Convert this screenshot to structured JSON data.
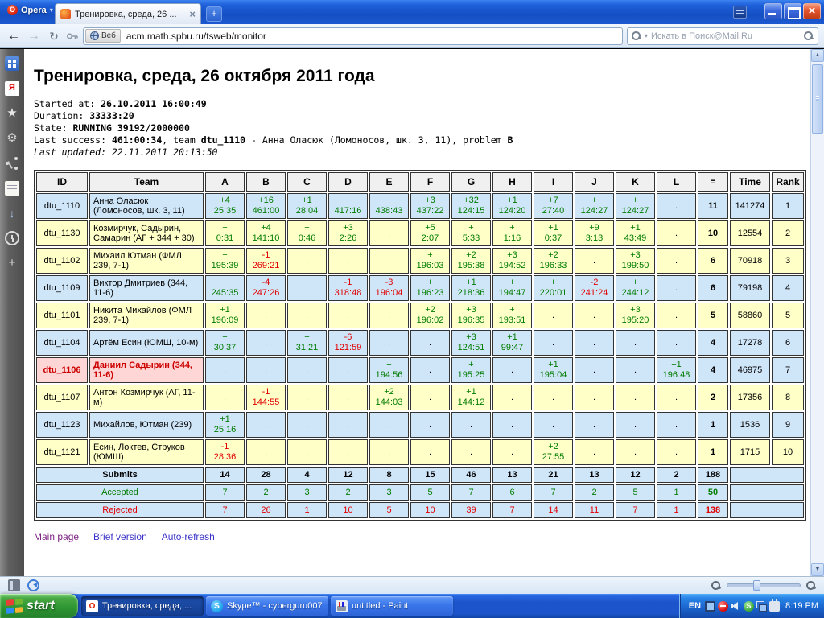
{
  "colors": {
    "accepted": "#007c00",
    "rejected": "#e00000",
    "row_blue": "#cfe5f8",
    "row_yellow": "#ffffc8",
    "header_bg": "#f0f0f0",
    "highlight_bg": "#ffd6d6",
    "highlight_text": "#cc0000"
  },
  "browser": {
    "app_name": "Opera",
    "tab_title": "Тренировка, среда, 26 ...",
    "address_scheme": "Веб",
    "address": "acm.math.spbu.ru/tsweb/monitor",
    "search_placeholder": "Искать в Поиск@Mail.Ru"
  },
  "sidebar": {
    "icons": [
      "speed-dial-icon",
      "yandex-icon",
      "bookmarks-icon",
      "widgets-icon",
      "opera-link-icon",
      "notes-icon",
      "downloads-icon",
      "history-icon",
      "add-panel-icon"
    ],
    "glyphs": {
      "yandex-icon": "Я",
      "bookmarks-icon": "★",
      "widgets-icon": "⚙",
      "downloads-icon": "↓",
      "add-panel-icon": "+"
    }
  },
  "page": {
    "title": "Тренировка, среда, 26 октября 2011 года",
    "info_lines": [
      [
        {
          "t": "Started at: "
        },
        {
          "t": "26.10.2011 16:00:49",
          "b": true
        }
      ],
      [
        {
          "t": "Duration: "
        },
        {
          "t": "33333:20",
          "b": true
        }
      ],
      [
        {
          "t": "State: "
        },
        {
          "t": "RUNNING 39192/2000000",
          "b": true
        }
      ],
      [
        {
          "t": "Last success: "
        },
        {
          "t": "461:00:34",
          "b": true
        },
        {
          "t": ", team "
        },
        {
          "t": "dtu_1110",
          "b": true
        },
        {
          "t": " - Анна Оласюк (Ломоносов, шк. 3, 11)"
        },
        {
          "t": ", problem "
        },
        {
          "t": "B",
          "b": true
        }
      ],
      [
        {
          "t": "Last updated: 22.11.2011 20:13:50",
          "i": true
        }
      ]
    ],
    "footer_links": [
      {
        "label": "Main page",
        "color": "#7b2382"
      },
      {
        "label": "Brief version",
        "color": "#3c34c8"
      },
      {
        "label": "Auto-refresh",
        "color": "#3c34c8"
      }
    ]
  },
  "table": {
    "headers": [
      "ID",
      "Team",
      "A",
      "B",
      "C",
      "D",
      "E",
      "F",
      "G",
      "H",
      "I",
      "J",
      "K",
      "L",
      "=",
      "Time",
      "Rank"
    ],
    "rows": [
      {
        "id": "dtu_1110",
        "team": "Анна Оласюк (Ломоносов, шк. 3, 11)",
        "color": "blue",
        "highlight": false,
        "cells": [
          "+4 25:35",
          "+16 461:00",
          "+1 28:04",
          "+ 417:16",
          "+ 438:43",
          "+3 437:22",
          "+32 124:15",
          "+1 124:20",
          "+7 27:40",
          "+ 124:27",
          "+ 124:27",
          "."
        ],
        "solved": "11",
        "time": "141274",
        "rank": "1"
      },
      {
        "id": "dtu_1130",
        "team": "Козмирчук, Садырин, Самарин (АГ + 344 + 30)",
        "color": "yellow",
        "highlight": false,
        "cells": [
          "+ 0:31",
          "+4 141:10",
          "+ 0:46",
          "+3 2:26",
          ".",
          "+5 2:07",
          "+ 5:33",
          "+ 1:16",
          "+1 0:37",
          "+9 3:13",
          "+1 43:49",
          "."
        ],
        "solved": "10",
        "time": "12554",
        "rank": "2"
      },
      {
        "id": "dtu_1102",
        "team": "Михаил Ютман (ФМЛ 239, 7-1)",
        "color": "yellow",
        "highlight": false,
        "cells": [
          "+ 195:39",
          "-1 269:21",
          ".",
          ".",
          ".",
          "+ 196:03",
          "+2 195:38",
          "+3 194:52",
          "+2 196:33",
          ".",
          "+3 199:50",
          "."
        ],
        "solved": "6",
        "time": "70918",
        "rank": "3"
      },
      {
        "id": "dtu_1109",
        "team": "Виктор Дмитриев (344, 11-6)",
        "color": "blue",
        "highlight": false,
        "cells": [
          "+ 245:35",
          "-4 247:26",
          ".",
          "-1 318:48",
          "-3 196:04",
          "+ 196:23",
          "+1 218:36",
          "+ 194:47",
          "+ 220:01",
          "-2 241:24",
          "+ 244:12",
          "."
        ],
        "solved": "6",
        "time": "79198",
        "rank": "4"
      },
      {
        "id": "dtu_1101",
        "team": "Никита Михайлов (ФМЛ 239, 7-1)",
        "color": "yellow",
        "highlight": false,
        "cells": [
          "+1 196:09",
          ".",
          ".",
          ".",
          ".",
          "+2 196:02",
          "+3 196:35",
          "+ 193:51",
          ".",
          ".",
          "+3 195:20",
          "."
        ],
        "solved": "5",
        "time": "58860",
        "rank": "5"
      },
      {
        "id": "dtu_1104",
        "team": "Артём Есин (ЮМШ, 10-м)",
        "color": "blue",
        "highlight": false,
        "cells": [
          "+ 30:37",
          ".",
          "+ 31:21",
          "-6 121:59",
          ".",
          ".",
          "+3 124:51",
          "+1 99:47",
          ".",
          ".",
          ".",
          "."
        ],
        "solved": "4",
        "time": "17278",
        "rank": "6"
      },
      {
        "id": "dtu_1106",
        "team": "Даниил Садырин (344, 11-6)",
        "color": "blue",
        "highlight": true,
        "cells": [
          ".",
          ".",
          ".",
          ".",
          "+ 194:56",
          ".",
          "+ 195:25",
          ".",
          "+1 195:04",
          ".",
          ".",
          "+1 196:48"
        ],
        "solved": "4",
        "time": "46975",
        "rank": "7"
      },
      {
        "id": "dtu_1107",
        "team": "Антон Козмирчук (АГ, 11-м)",
        "color": "yellow",
        "highlight": false,
        "cells": [
          ".",
          "-1 144:55",
          ".",
          ".",
          "+2 144:03",
          ".",
          "+1 144:12",
          ".",
          ".",
          ".",
          ".",
          "."
        ],
        "solved": "2",
        "time": "17356",
        "rank": "8"
      },
      {
        "id": "dtu_1123",
        "team": "Михайлов, Ютман (239)",
        "color": "blue",
        "highlight": false,
        "cells": [
          "+1 25:16",
          ".",
          ".",
          ".",
          ".",
          ".",
          ".",
          ".",
          ".",
          ".",
          ".",
          "."
        ],
        "solved": "1",
        "time": "1536",
        "rank": "9"
      },
      {
        "id": "dtu_1121",
        "team": "Есин, Локтев, Струков (ЮМШ)",
        "color": "yellow",
        "highlight": false,
        "cells": [
          "-1 28:36",
          ".",
          ".",
          ".",
          ".",
          ".",
          ".",
          ".",
          "+2 27:55",
          ".",
          ".",
          "."
        ],
        "solved": "1",
        "time": "1715",
        "rank": "10"
      }
    ],
    "summary": [
      {
        "label": "Submits",
        "style": "submits",
        "values": [
          "14",
          "28",
          "4",
          "12",
          "8",
          "15",
          "46",
          "13",
          "21",
          "13",
          "12",
          "2"
        ],
        "total": "188"
      },
      {
        "label": "Accepted",
        "style": "accepted",
        "values": [
          "7",
          "2",
          "3",
          "2",
          "3",
          "5",
          "7",
          "6",
          "7",
          "2",
          "5",
          "1"
        ],
        "total": "50"
      },
      {
        "label": "Rejected",
        "style": "rejected",
        "values": [
          "7",
          "26",
          "1",
          "10",
          "5",
          "10",
          "39",
          "7",
          "14",
          "11",
          "7",
          "1"
        ],
        "total": "138"
      }
    ]
  },
  "statusbar": {
    "icons": [
      "panel-toggle-icon",
      "sync-icon"
    ]
  },
  "taskbar": {
    "start_label": "start",
    "buttons": [
      {
        "label": "Тренировка, среда, ...",
        "icon": "opera",
        "active": true
      },
      {
        "label": "Skype™ - cyberguru007",
        "icon": "skype",
        "active": false
      },
      {
        "label": "untitled - Paint",
        "icon": "paint",
        "active": false
      }
    ],
    "tray": {
      "lang": "EN",
      "icons": [
        "monitor-icon",
        "alert-icon",
        "volume-icon",
        "skype-icon",
        "network-icon",
        "power-icon"
      ],
      "clock": "8:19 PM"
    }
  }
}
